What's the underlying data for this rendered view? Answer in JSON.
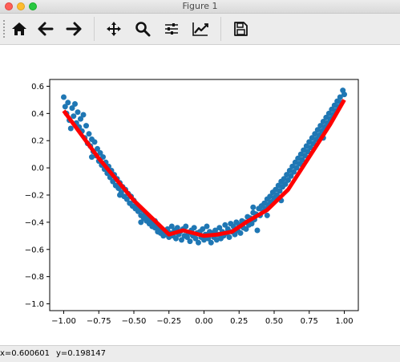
{
  "window": {
    "title": "Figure 1"
  },
  "toolbar": {
    "buttons": [
      {
        "icon": "home-icon"
      },
      {
        "icon": "back-arrow-icon"
      },
      {
        "icon": "forward-arrow-icon"
      },
      {
        "icon": "pan-icon"
      },
      {
        "icon": "zoom-icon"
      },
      {
        "icon": "configure-subplots-icon"
      },
      {
        "icon": "edit-axis-icon"
      },
      {
        "icon": "save-icon"
      }
    ]
  },
  "status": {
    "x": "x=0.600601",
    "y": "y=0.198147"
  },
  "chart_data": {
    "type": "scatter",
    "xlim": [
      -1.1,
      1.1
    ],
    "ylim": [
      -1.05,
      0.65
    ],
    "xticks": [
      -1.0,
      -0.75,
      -0.5,
      -0.25,
      0.0,
      0.25,
      0.5,
      0.75,
      1.0
    ],
    "xtick_labels": [
      "−1.00",
      "−0.75",
      "−0.50",
      "−0.25",
      "0.00",
      "0.25",
      "0.50",
      "0.75",
      "1.00"
    ],
    "yticks": [
      0.6,
      0.4,
      0.2,
      0.0,
      -0.2,
      -0.4,
      -0.6,
      -0.8,
      -1.0
    ],
    "ytick_labels": [
      "0.6",
      "0.4",
      "0.2",
      "0.0",
      "−0.2",
      "−0.4",
      "−0.6",
      "−0.8",
      "−1.0"
    ],
    "grid": false,
    "colors": {
      "scatter": "#1f77b4",
      "line": "#ff0000"
    },
    "scatter_points": [
      [
        -1.0,
        0.52
      ],
      [
        -0.99,
        0.45
      ],
      [
        -0.98,
        0.4
      ],
      [
        -0.97,
        0.48
      ],
      [
        -0.96,
        0.35
      ],
      [
        -0.95,
        0.29
      ],
      [
        -0.94,
        0.44
      ],
      [
        -0.93,
        0.38
      ],
      [
        -0.92,
        0.47
      ],
      [
        -0.91,
        0.33
      ],
      [
        -0.9,
        0.41
      ],
      [
        -0.89,
        0.3
      ],
      [
        -0.88,
        0.36
      ],
      [
        -0.87,
        0.27
      ],
      [
        -0.86,
        0.39
      ],
      [
        -0.85,
        0.22
      ],
      [
        -0.84,
        0.31
      ],
      [
        -0.83,
        0.18
      ],
      [
        -0.82,
        0.25
      ],
      [
        -0.81,
        0.16
      ],
      [
        -0.8,
        0.21
      ],
      [
        -0.79,
        0.12
      ],
      [
        -0.78,
        0.19
      ],
      [
        -0.77,
        0.09
      ],
      [
        -0.76,
        0.14
      ],
      [
        -0.75,
        0.05
      ],
      [
        -0.74,
        0.11
      ],
      [
        -0.73,
        0.02
      ],
      [
        -0.72,
        0.08
      ],
      [
        -0.71,
        -0.01
      ],
      [
        -0.7,
        0.04
      ],
      [
        -0.69,
        -0.04
      ],
      [
        -0.68,
        0.01
      ],
      [
        -0.67,
        -0.07
      ],
      [
        -0.66,
        -0.02
      ],
      [
        -0.65,
        -0.1
      ],
      [
        -0.64,
        -0.05
      ],
      [
        -0.63,
        -0.13
      ],
      [
        -0.62,
        -0.08
      ],
      [
        -0.61,
        -0.15
      ],
      [
        -0.6,
        -0.11
      ],
      [
        -0.59,
        -0.18
      ],
      [
        -0.58,
        -0.14
      ],
      [
        -0.57,
        -0.21
      ],
      [
        -0.56,
        -0.16
      ],
      [
        -0.55,
        -0.23
      ],
      [
        -0.54,
        -0.19
      ],
      [
        -0.53,
        -0.26
      ],
      [
        -0.52,
        -0.21
      ],
      [
        -0.51,
        -0.28
      ],
      [
        -0.5,
        -0.24
      ],
      [
        -0.49,
        -0.3
      ],
      [
        -0.48,
        -0.27
      ],
      [
        -0.47,
        -0.32
      ],
      [
        -0.46,
        -0.29
      ],
      [
        -0.45,
        -0.35
      ],
      [
        -0.44,
        -0.31
      ],
      [
        -0.43,
        -0.37
      ],
      [
        -0.42,
        -0.34
      ],
      [
        -0.41,
        -0.39
      ],
      [
        -0.4,
        -0.36
      ],
      [
        -0.39,
        -0.41
      ],
      [
        -0.38,
        -0.38
      ],
      [
        -0.37,
        -0.43
      ],
      [
        -0.36,
        -0.4
      ],
      [
        -0.35,
        -0.44
      ],
      [
        -0.34,
        -0.42
      ],
      [
        -0.33,
        -0.47
      ],
      [
        -0.32,
        -0.44
      ],
      [
        -0.31,
        -0.48
      ],
      [
        -0.3,
        -0.46
      ],
      [
        -0.29,
        -0.5
      ],
      [
        -0.28,
        -0.47
      ],
      [
        -0.27,
        -0.49
      ],
      [
        -0.26,
        -0.45
      ],
      [
        -0.25,
        -0.51
      ],
      [
        -0.24,
        -0.48
      ],
      [
        -0.23,
        -0.43
      ],
      [
        -0.22,
        -0.5
      ],
      [
        -0.21,
        -0.46
      ],
      [
        -0.2,
        -0.52
      ],
      [
        -0.19,
        -0.44
      ],
      [
        -0.18,
        -0.49
      ],
      [
        -0.17,
        -0.47
      ],
      [
        -0.16,
        -0.53
      ],
      [
        -0.15,
        -0.45
      ],
      [
        -0.14,
        -0.5
      ],
      [
        -0.13,
        -0.43
      ],
      [
        -0.12,
        -0.51
      ],
      [
        -0.11,
        -0.48
      ],
      [
        -0.1,
        -0.54
      ],
      [
        -0.09,
        -0.46
      ],
      [
        -0.08,
        -0.5
      ],
      [
        -0.07,
        -0.44
      ],
      [
        -0.06,
        -0.52
      ],
      [
        -0.05,
        -0.48
      ],
      [
        -0.04,
        -0.55
      ],
      [
        -0.03,
        -0.47
      ],
      [
        -0.02,
        -0.51
      ],
      [
        -0.01,
        -0.45
      ],
      [
        0.0,
        -0.53
      ],
      [
        0.01,
        -0.49
      ],
      [
        0.02,
        -0.43
      ],
      [
        0.03,
        -0.52
      ],
      [
        0.04,
        -0.47
      ],
      [
        0.05,
        -0.55
      ],
      [
        0.06,
        -0.48
      ],
      [
        0.07,
        -0.51
      ],
      [
        0.08,
        -0.46
      ],
      [
        0.09,
        -0.53
      ],
      [
        0.1,
        -0.49
      ],
      [
        0.11,
        -0.44
      ],
      [
        0.12,
        -0.52
      ],
      [
        0.13,
        -0.47
      ],
      [
        0.14,
        -0.5
      ],
      [
        0.15,
        -0.42
      ],
      [
        0.16,
        -0.48
      ],
      [
        0.17,
        -0.45
      ],
      [
        0.18,
        -0.51
      ],
      [
        0.19,
        -0.41
      ],
      [
        0.2,
        -0.47
      ],
      [
        0.21,
        -0.43
      ],
      [
        0.22,
        -0.49
      ],
      [
        0.23,
        -0.4
      ],
      [
        0.24,
        -0.46
      ],
      [
        0.25,
        -0.42
      ],
      [
        0.26,
        -0.48
      ],
      [
        0.27,
        -0.39
      ],
      [
        0.28,
        -0.44
      ],
      [
        0.29,
        -0.4
      ],
      [
        0.3,
        -0.45
      ],
      [
        0.31,
        -0.36
      ],
      [
        0.32,
        -0.42
      ],
      [
        0.33,
        -0.37
      ],
      [
        0.34,
        -0.41
      ],
      [
        0.35,
        -0.33
      ],
      [
        0.36,
        -0.38
      ],
      [
        0.37,
        -0.34
      ],
      [
        0.38,
        -0.46
      ],
      [
        0.39,
        -0.3
      ],
      [
        0.4,
        -0.35
      ],
      [
        0.41,
        -0.28
      ],
      [
        0.42,
        -0.32
      ],
      [
        0.43,
        -0.26
      ],
      [
        0.44,
        -0.3
      ],
      [
        0.45,
        -0.23
      ],
      [
        0.46,
        -0.27
      ],
      [
        0.47,
        -0.21
      ],
      [
        0.48,
        -0.25
      ],
      [
        0.49,
        -0.18
      ],
      [
        0.5,
        -0.22
      ],
      [
        0.51,
        -0.16
      ],
      [
        0.52,
        -0.2
      ],
      [
        0.53,
        -0.13
      ],
      [
        0.54,
        -0.17
      ],
      [
        0.55,
        -0.1
      ],
      [
        0.56,
        -0.14
      ],
      [
        0.57,
        -0.08
      ],
      [
        0.58,
        -0.12
      ],
      [
        0.59,
        -0.05
      ],
      [
        0.6,
        -0.09
      ],
      [
        0.61,
        -0.02
      ],
      [
        0.62,
        -0.06
      ],
      [
        0.63,
        0.01
      ],
      [
        0.64,
        -0.03
      ],
      [
        0.65,
        0.04
      ],
      [
        0.66,
        0.0
      ],
      [
        0.67,
        0.07
      ],
      [
        0.68,
        0.03
      ],
      [
        0.69,
        0.1
      ],
      [
        0.7,
        0.06
      ],
      [
        0.71,
        0.13
      ],
      [
        0.72,
        0.09
      ],
      [
        0.73,
        0.16
      ],
      [
        0.74,
        0.12
      ],
      [
        0.75,
        0.19
      ],
      [
        0.76,
        0.15
      ],
      [
        0.77,
        0.22
      ],
      [
        0.78,
        0.18
      ],
      [
        0.79,
        0.25
      ],
      [
        0.8,
        0.21
      ],
      [
        0.81,
        0.28
      ],
      [
        0.82,
        0.24
      ],
      [
        0.83,
        0.31
      ],
      [
        0.84,
        0.27
      ],
      [
        0.85,
        0.34
      ],
      [
        0.86,
        0.3
      ],
      [
        0.87,
        0.37
      ],
      [
        0.88,
        0.33
      ],
      [
        0.89,
        0.4
      ],
      [
        0.9,
        0.36
      ],
      [
        0.91,
        0.43
      ],
      [
        0.92,
        0.39
      ],
      [
        0.93,
        0.46
      ],
      [
        0.94,
        0.42
      ],
      [
        0.95,
        0.49
      ],
      [
        0.96,
        0.45
      ],
      [
        0.97,
        0.52
      ],
      [
        0.98,
        0.48
      ],
      [
        0.99,
        0.57
      ],
      [
        1.0,
        0.54
      ],
      [
        -0.8,
        0.08
      ],
      [
        -0.6,
        -0.2
      ],
      [
        -0.45,
        -0.4
      ],
      [
        -0.35,
        -0.39
      ],
      [
        0.35,
        -0.29
      ],
      [
        0.45,
        -0.35
      ],
      [
        0.55,
        -0.24
      ],
      [
        0.7,
        0.02
      ],
      [
        0.85,
        0.22
      ]
    ],
    "line_points": [
      [
        -1.0,
        0.42
      ],
      [
        -0.75,
        0.07
      ],
      [
        -0.5,
        -0.24
      ],
      [
        -0.25,
        -0.49
      ],
      [
        -0.15,
        -0.46
      ],
      [
        0.0,
        -0.5
      ],
      [
        0.1,
        -0.49
      ],
      [
        0.2,
        -0.47
      ],
      [
        0.3,
        -0.4
      ],
      [
        0.45,
        -0.31
      ],
      [
        0.6,
        -0.16
      ],
      [
        0.75,
        0.08
      ],
      [
        0.9,
        0.32
      ],
      [
        1.0,
        0.5
      ]
    ]
  }
}
